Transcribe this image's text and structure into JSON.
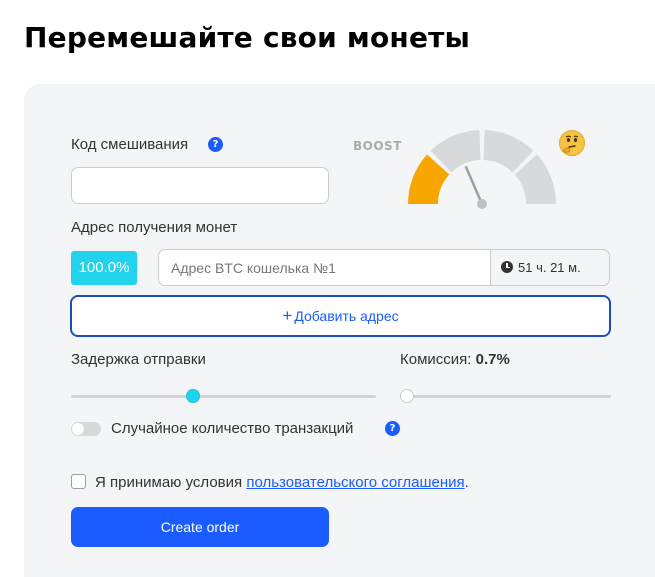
{
  "page": {
    "title": "Перемешайте свои монеты"
  },
  "form": {
    "mix_code_label": "Код смешивания",
    "mix_code_value": "",
    "help_glyph": "?",
    "boost_label": "BOOST",
    "boost_level": 0.25,
    "address_label": "Адрес получения монет",
    "address_percent": "100.0%",
    "address_placeholder": "Адрес BTC кошелька №1",
    "address_value": "",
    "delay_time": "51 ч. 21 м.",
    "add_address_plus": "+",
    "add_address_label": "Добавить адрес",
    "delay_label": "Задержка отправки",
    "delay_level": 0.4,
    "fee_label": "Комиссия:",
    "fee_value": "0.7%",
    "fee_level": 0,
    "random_tx_label": "Случайное количество транзакций",
    "random_tx_enabled": false,
    "terms_prefix": "Я принимаю условия",
    "terms_link": "пользовательского соглашения",
    "terms_suffix": ".",
    "terms_accepted": false,
    "create_button": "Create order"
  },
  "colors": {
    "accent": "#1a5cff",
    "percent_badge": "#22d3ee",
    "gauge_active": "#f7a600",
    "gauge_inactive": "#d8d9db",
    "panel_bg": "#f4f5f7"
  },
  "icons": {
    "help": "question-circle-icon",
    "clock": "clock-icon",
    "thinking": "thinking-face-icon",
    "gauge": "speedometer-gauge"
  }
}
